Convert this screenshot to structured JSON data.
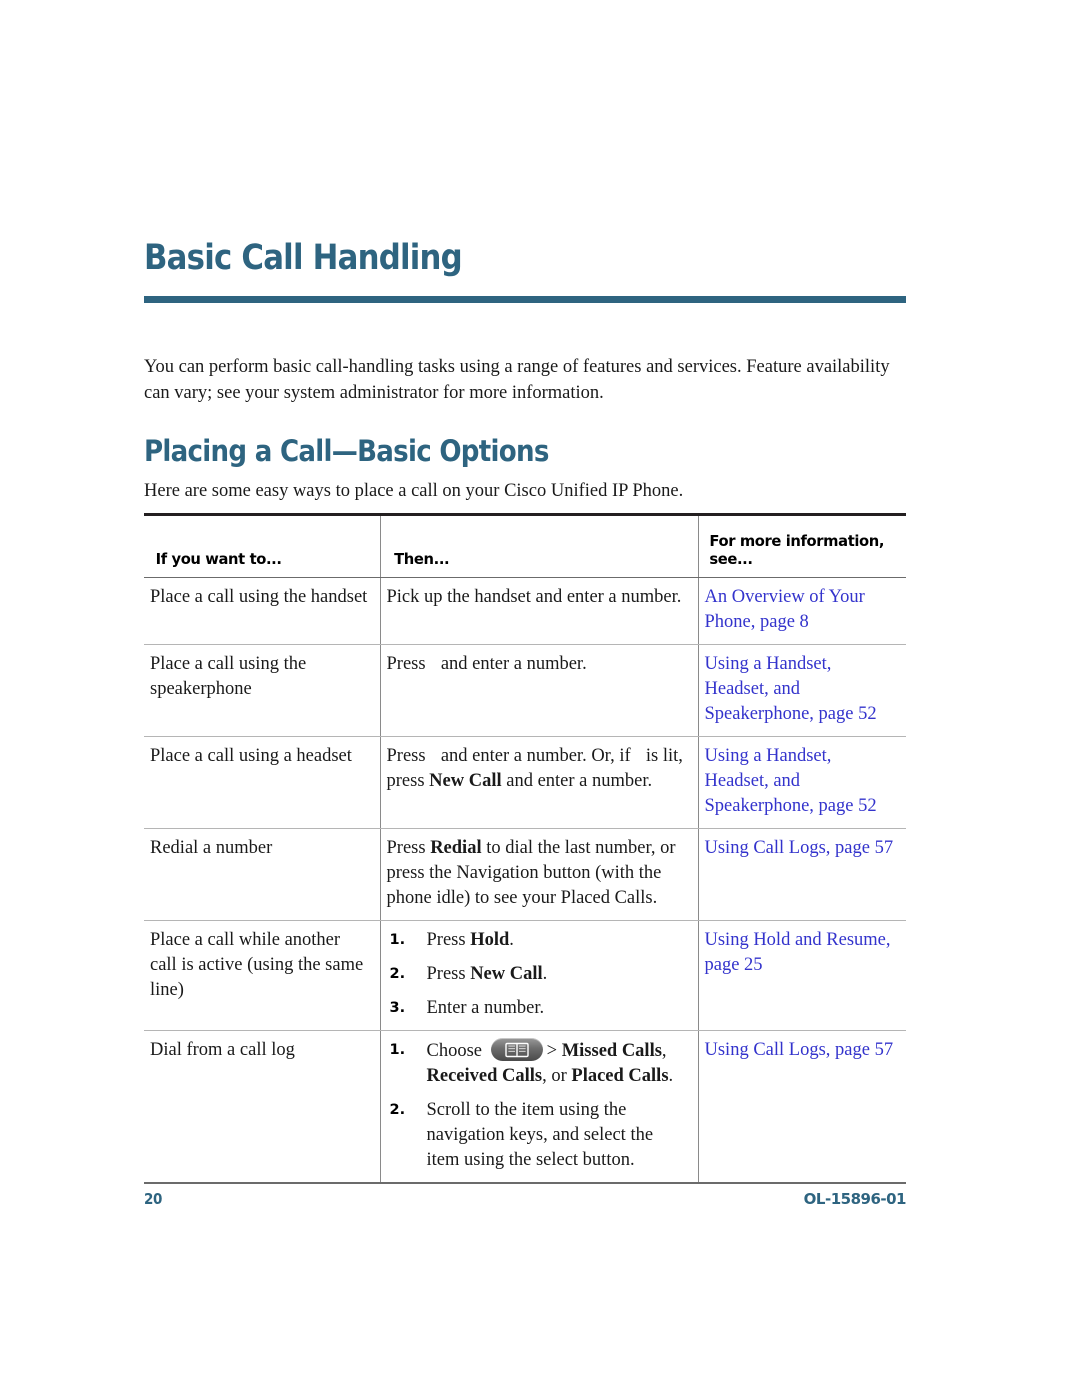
{
  "page": {
    "chapter_title": "Basic Call Handling",
    "intro": "You can perform basic call-handling tasks using a range of features and services. Feature availability can vary; see your system administrator for more information.",
    "section_title": "Placing a Call—Basic Options",
    "section_lead": "Here are some easy ways to place a call on your Cisco Unified IP Phone.",
    "accent_color": "#2e6480",
    "link_color": "#3333cc"
  },
  "table": {
    "headers": {
      "col1": "If you want to...",
      "col2": "Then...",
      "col3_line1": "For more information,",
      "col3_line2": "see..."
    },
    "rows": [
      {
        "want": "Place a call using the handset",
        "then_plain": "Pick up the handset and enter a number.",
        "refs": [
          "An Overview of Your",
          "Phone, page 8"
        ]
      },
      {
        "want": "Place a call using the speakerphone",
        "then_pre": "Press",
        "then_post": "and enter a number.",
        "icon": "speakerphone-icon",
        "refs": [
          "Using a Handset,",
          "Headset, and",
          "Speakerphone, page 52"
        ]
      },
      {
        "want": "Place a call using a headset",
        "then_pre": "Press",
        "then_mid": "and enter a number. Or, if",
        "then_post_a": "is lit, press",
        "then_bold": "New Call",
        "then_post_b": "and enter a number.",
        "icon": "headset-icon",
        "icon_lit": "headset-lit-icon",
        "refs": [
          "Using a Handset,",
          "Headset, and",
          "Speakerphone, page 52"
        ]
      },
      {
        "want": "Redial a number",
        "then_pre": "Press",
        "then_bold": "Redial",
        "then_post": "to dial the last number, or press the Navigation button (with the phone idle) to see your Placed Calls.",
        "refs": [
          "Using Call Logs, page 57"
        ]
      },
      {
        "want": "Place a call while another call is active (using the same line)",
        "steps": [
          {
            "num": "1.",
            "pre": "Press ",
            "bold": "Hold",
            "post": "."
          },
          {
            "num": "2.",
            "pre": "Press ",
            "bold": "New Call",
            "post": "."
          },
          {
            "num": "3.",
            "pre": "Enter a number.",
            "bold": "",
            "post": ""
          }
        ],
        "refs": [
          "Using Hold and Resume,",
          "page 25"
        ]
      },
      {
        "want": "Dial from a call log",
        "steps_icon": [
          {
            "num": "1.",
            "pre": "Choose",
            "icon": "directories-icon",
            "post_a": "> ",
            "bold_a": "Missed Calls",
            "mid": ", ",
            "bold_b": "Received Calls",
            "post_b": ", or ",
            "bold_c": "Placed Calls",
            "end": "."
          },
          {
            "num": "2.",
            "text": "Scroll to the item using the navigation keys, and select the item using the select button."
          }
        ],
        "refs": [
          "Using Call Logs, page 57"
        ]
      }
    ]
  },
  "footer": {
    "page_number": "20",
    "doc_id": "OL-15896-01"
  }
}
